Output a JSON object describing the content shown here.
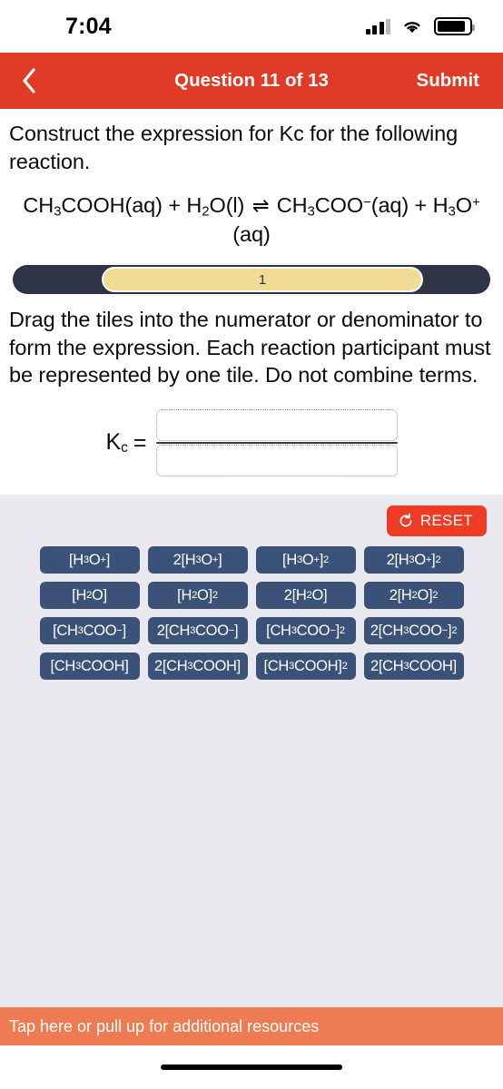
{
  "status_bar": {
    "time": "7:04",
    "signal_icon": "cellular-signal-icon",
    "wifi_icon": "wifi-icon",
    "battery_icon": "battery-icon"
  },
  "nav_bar": {
    "back_icon": "back-chevron-icon",
    "title": "Question 11 of 13",
    "submit_label": "Submit",
    "background_color": "#E03B27"
  },
  "question": {
    "prompt": "Construct the expression for Kc for the following reaction.",
    "equation": {
      "reactant_1": "CH₃COOH(aq)",
      "plus_1": "+",
      "reactant_2": "H₂O(l)",
      "arrow": "⇌",
      "product_1": "CH₃COO⁻(aq)",
      "plus_2": "+",
      "product_2": "H₃O⁺(aq)"
    }
  },
  "progress": {
    "current_part": "1",
    "track_color": "#2E3446",
    "fill_color": "#F2DC95"
  },
  "instructions": "Drag the tiles into the numerator or denominator to form the expression. Each reaction participant must be represented by one tile. Do not combine terms.",
  "answer_area": {
    "kc_label": "K",
    "kc_subscript": "c",
    "equals": "=",
    "numerator_value": "",
    "denominator_value": "",
    "numerator_placeholder": "",
    "denominator_placeholder": ""
  },
  "tile_panel": {
    "background_color": "#E9E9EF",
    "reset": {
      "label": "RESET",
      "icon": "reset-circular-arrow-icon",
      "color": "#EE3B23"
    },
    "tile_color": "#3A5278",
    "tiles": [
      {
        "id": "h3o-1",
        "html": "[H<sub>3</sub>O<sup>+</sup>]",
        "text": "[H₃O⁺]"
      },
      {
        "id": "h3o-2",
        "html": "2[H<sub>3</sub>O<sup>+</sup>]",
        "text": "2[H₃O⁺]"
      },
      {
        "id": "h3o-3",
        "html": "[H<sub>3</sub>O<sup>+</sup>]<sup>2</sup>",
        "text": "[H₃O⁺]²"
      },
      {
        "id": "h3o-4",
        "html": "2[H<sub>3</sub>O<sup>+</sup>]<sup>2</sup>",
        "text": "2[H₃O⁺]²"
      },
      {
        "id": "h2o-1",
        "html": "[H<sub>2</sub>O]",
        "text": "[H₂O]"
      },
      {
        "id": "h2o-2",
        "html": "[H<sub>2</sub>O]<sup>2</sup>",
        "text": "[H₂O]²"
      },
      {
        "id": "h2o-3",
        "html": "2[H<sub>2</sub>O]",
        "text": "2[H₂O]"
      },
      {
        "id": "h2o-4",
        "html": "2[H<sub>2</sub>O]<sup>2</sup>",
        "text": "2[H₂O]²"
      },
      {
        "id": "ch3coo-1",
        "html": "[CH<sub>3</sub>COO<sup>−</sup>]",
        "text": "[CH₃COO⁻]"
      },
      {
        "id": "ch3coo-2",
        "html": "2[CH<sub>3</sub>COO<sup>−</sup>]",
        "text": "2[CH₃COO⁻]"
      },
      {
        "id": "ch3coo-3",
        "html": "[CH<sub>3</sub>COO<sup>−</sup>]<sup>2</sup>",
        "text": "[CH₃COO⁻]²"
      },
      {
        "id": "ch3coo-4",
        "html": "2[CH<sub>3</sub>COO<sup>−</sup>]<sup>2</sup>",
        "text": "2[CH₃COO⁻]²"
      },
      {
        "id": "ch3cooh-1",
        "html": "[CH<sub>3</sub>COOH]",
        "text": "[CH₃COOH]"
      },
      {
        "id": "ch3cooh-2",
        "html": "2[CH<sub>3</sub>COOH]",
        "text": "2[CH₃COOH]"
      },
      {
        "id": "ch3cooh-3",
        "html": "[CH<sub>3</sub>COOH]<sup>2</sup>",
        "text": "[CH₃COOH]²"
      },
      {
        "id": "ch3cooh-4",
        "html": "2[CH<sub>3</sub>COOH]",
        "text": "2[CH₃COOH]"
      }
    ]
  },
  "resources_bar": {
    "label": "Tap here or pull up for additional resources",
    "color": "#EE7B52"
  }
}
